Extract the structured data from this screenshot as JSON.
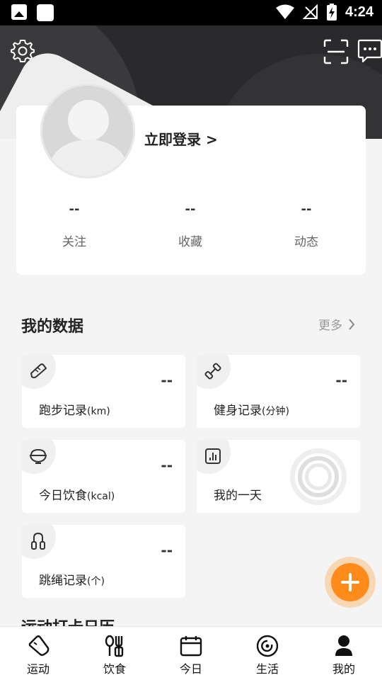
{
  "status_bar": {
    "time": "4:24"
  },
  "profile": {
    "login_label": "立即登录 >",
    "stats": [
      {
        "value": "--",
        "label": "关注"
      },
      {
        "value": "--",
        "label": "收藏"
      },
      {
        "value": "--",
        "label": "动态"
      }
    ]
  },
  "my_data": {
    "title": "我的数据",
    "more_label": "更多",
    "tiles": [
      {
        "label": "跑步记录",
        "unit": "(km)",
        "value": "--",
        "icon": "running-shoe-icon"
      },
      {
        "label": "健身记录",
        "unit": "(分钟)",
        "value": "--",
        "icon": "dumbbell-icon"
      },
      {
        "label": "今日饮食",
        "unit": "(kcal)",
        "value": "--",
        "icon": "bowl-icon"
      },
      {
        "label": "我的一天",
        "unit": "",
        "value": "",
        "icon": "bar-chart-icon"
      },
      {
        "label": "跳绳记录",
        "unit": "(个)",
        "value": "--",
        "icon": "jump-rope-icon"
      }
    ]
  },
  "next_section_title": "运动打卡日历",
  "tabbar": {
    "items": [
      {
        "label": "运动",
        "icon": "shoe-icon"
      },
      {
        "label": "饮食",
        "icon": "utensils-icon"
      },
      {
        "label": "今日",
        "icon": "calendar-icon"
      },
      {
        "label": "生活",
        "icon": "life-icon"
      },
      {
        "label": "我的",
        "icon": "person-icon"
      }
    ]
  },
  "colors": {
    "accent": "#ff8c1a",
    "header_dark": "#2a2a2c"
  }
}
